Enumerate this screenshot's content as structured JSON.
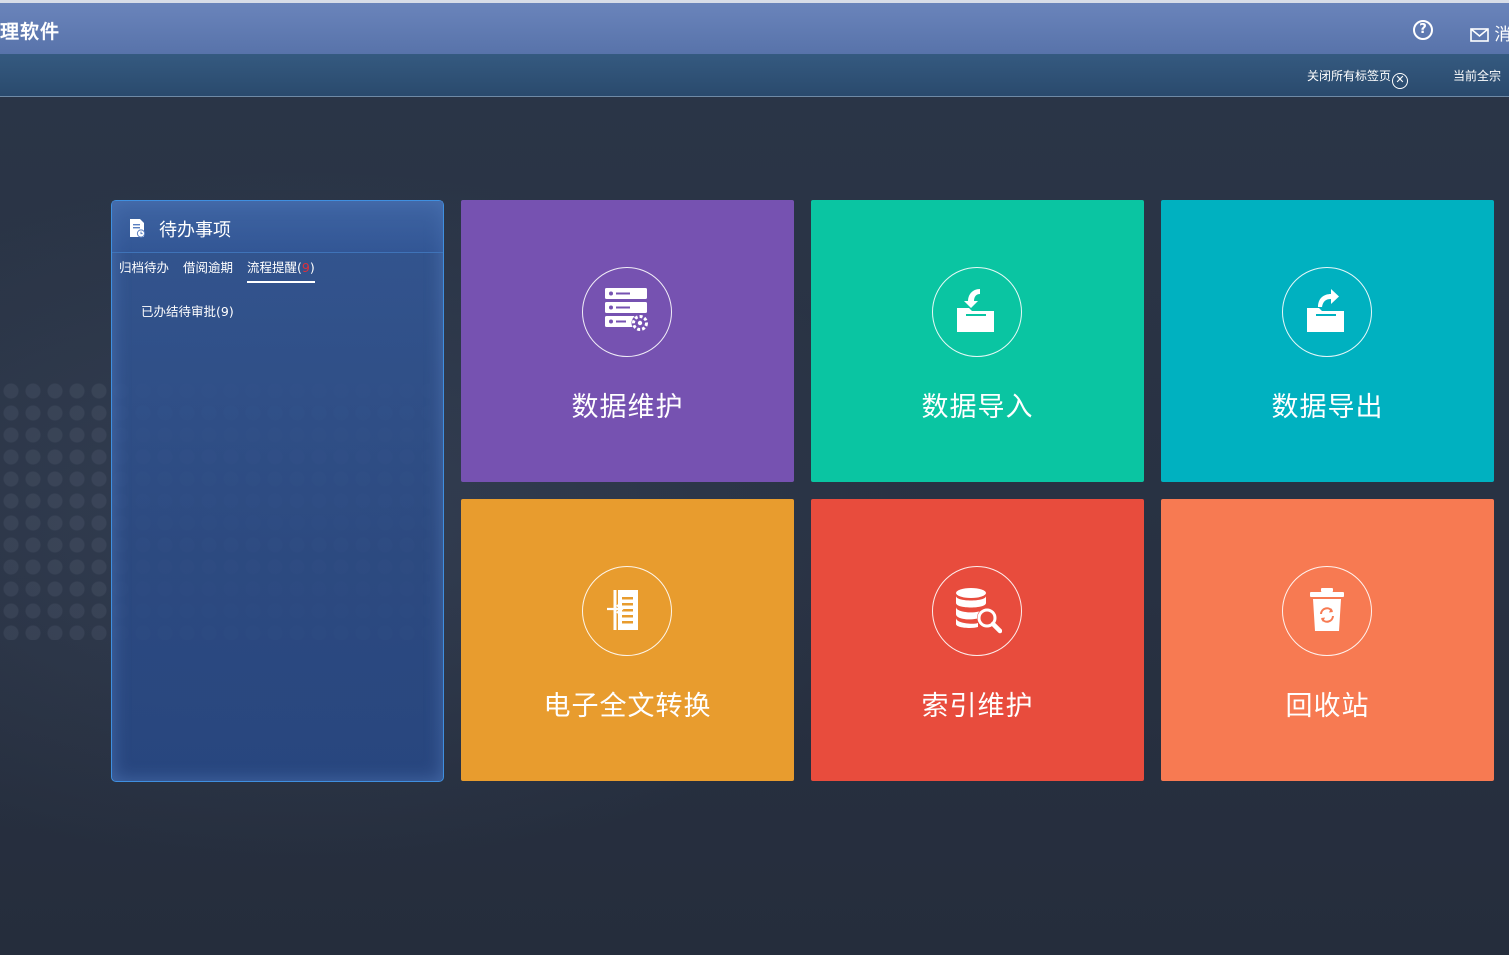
{
  "header": {
    "title": "理软件",
    "help_label": "?",
    "message_label": "消"
  },
  "tabbar": {
    "close_all": "关闭所有标签页",
    "current": "当前全宗"
  },
  "todo": {
    "title": "待办事项",
    "tabs": [
      {
        "label": "归档待办"
      },
      {
        "label": "借阅逾期"
      },
      {
        "label": "流程提醒(",
        "badge": "9",
        "suffix": ")"
      }
    ],
    "items": [
      {
        "label": "已办结待审批(9)"
      }
    ]
  },
  "tiles": [
    {
      "label": "数据维护",
      "color": "#7652b1",
      "icon": "server-gear-icon"
    },
    {
      "label": "数据导入",
      "color": "#0ac5a2",
      "icon": "folder-import-icon"
    },
    {
      "label": "数据导出",
      "color": "#00b1c0",
      "icon": "folder-export-icon"
    },
    {
      "label": "电子全文转换",
      "color": "#e89c2e",
      "icon": "document-convert-icon"
    },
    {
      "label": "索引维护",
      "color": "#e84c3d",
      "icon": "database-search-icon"
    },
    {
      "label": "回收站",
      "color": "#f77a52",
      "icon": "trash-recycle-icon"
    }
  ]
}
